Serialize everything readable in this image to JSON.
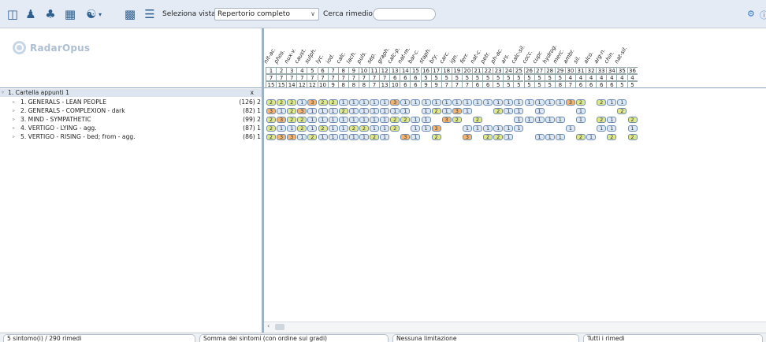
{
  "toolbar": {
    "view_label": "Seleziona vista",
    "view_value": "Repertorio completo",
    "search_label": "Cerca rimedio:",
    "search_value": "",
    "icons": [
      "window-icon",
      "person-icon",
      "tree-icon",
      "book-icon",
      "yin-yang-icon",
      "compare-icon",
      "list-icon"
    ]
  },
  "logo_text": "RadarOpus",
  "clipboard": {
    "title": "1. Cartella appunti 1",
    "close": "x",
    "rubrics": [
      {
        "label": "1. GENERALS - LEAN PEOPLE",
        "count": "(126) 2"
      },
      {
        "label": "2. GENERALS - COMPLEXION - dark",
        "count": "(82) 1"
      },
      {
        "label": "3. MIND - SYMPATHETIC",
        "count": "(99) 2"
      },
      {
        "label": "4. VERTIGO - LYING - agg.",
        "count": "(87) 1"
      },
      {
        "label": "5. VERTIGO - RISING - bed; from - agg.",
        "count": "(86) 1"
      }
    ]
  },
  "remedies": [
    "nit-ac.",
    "phos.",
    "nux-v.",
    "caust.",
    "sulph.",
    "lyc.",
    "iod.",
    "calc.",
    "lach.",
    "puls.",
    "sep.",
    "graph.",
    "calc-p.",
    "nat-m.",
    "bar-c.",
    "staph.",
    "bry.",
    "carc.",
    "ign.",
    "ferr.",
    "nat-c.",
    "petr.",
    "ph-ac.",
    "ars.",
    "calc-sil.",
    "cocc.",
    "cupr.",
    "hydrog.",
    "merc.",
    "ambr.",
    "sil.",
    "alco.",
    "arg-n.",
    "chin.",
    "nat-sil."
  ],
  "rank_row": [
    "1",
    "2",
    "3",
    "4",
    "5",
    "6",
    "7",
    "8",
    "9",
    "10",
    "11",
    "12",
    "13",
    "14",
    "15",
    "16",
    "17",
    "18",
    "19",
    "20",
    "21",
    "22",
    "23",
    "24",
    "25",
    "26",
    "27",
    "28",
    "29",
    "30",
    "31",
    "32",
    "33",
    "34",
    "35",
    "36"
  ],
  "hits_row": [
    "7",
    "7",
    "7",
    "7",
    "7",
    "7",
    "7",
    "7",
    "7",
    "7",
    "7",
    "7",
    "6",
    "6",
    "6",
    "5",
    "5",
    "5",
    "5",
    "5",
    "5",
    "5",
    "5",
    "5",
    "5",
    "5",
    "5",
    "5",
    "5",
    "4",
    "4",
    "4",
    "4",
    "4",
    "4",
    "4"
  ],
  "score_row": [
    "15",
    "15",
    "14",
    "12",
    "12",
    "10",
    "9",
    "8",
    "8",
    "8",
    "7",
    "13",
    "10",
    "6",
    "6",
    "9",
    "9",
    "7",
    "7",
    "7",
    "6",
    "6",
    "5",
    "5",
    "5",
    "5",
    "5",
    "5",
    "8",
    "7",
    "6",
    "6",
    "6",
    "6",
    "5",
    "5"
  ],
  "grid": [
    [
      2,
      2,
      2,
      1,
      3,
      2,
      2,
      1,
      1,
      1,
      1,
      1,
      3,
      1,
      1,
      1,
      1,
      1,
      1,
      1,
      1,
      1,
      1,
      1,
      1,
      1,
      1,
      1,
      1,
      3,
      2,
      0,
      2,
      1,
      1,
      0
    ],
    [
      3,
      1,
      2,
      3,
      1,
      1,
      1,
      2,
      1,
      1,
      1,
      1,
      1,
      1,
      0,
      1,
      2,
      1,
      3,
      1,
      0,
      0,
      2,
      1,
      1,
      0,
      1,
      0,
      0,
      0,
      1,
      0,
      0,
      0,
      2,
      0
    ],
    [
      2,
      3,
      2,
      2,
      1,
      1,
      1,
      1,
      1,
      1,
      1,
      1,
      2,
      2,
      1,
      1,
      0,
      3,
      2,
      0,
      2,
      0,
      0,
      0,
      1,
      1,
      1,
      1,
      1,
      0,
      1,
      0,
      2,
      1,
      0,
      2
    ],
    [
      2,
      1,
      1,
      2,
      1,
      2,
      1,
      1,
      2,
      2,
      1,
      1,
      2,
      0,
      1,
      1,
      3,
      0,
      0,
      1,
      1,
      1,
      1,
      1,
      1,
      0,
      0,
      0,
      0,
      1,
      0,
      0,
      1,
      1,
      0,
      1
    ],
    [
      2,
      3,
      3,
      1,
      2,
      1,
      1,
      1,
      1,
      1,
      2,
      1,
      0,
      3,
      1,
      0,
      2,
      0,
      0,
      3,
      0,
      2,
      2,
      1,
      0,
      0,
      1,
      1,
      1,
      0,
      2,
      1,
      0,
      2,
      0,
      2
    ]
  ],
  "status": [
    "5 sintomo(i) / 290 rimedi",
    "Somma dei sintomi (con ordine sui gradi)",
    "Nessuna limitazione",
    "Tutti i rimedi"
  ],
  "colors": {
    "grade1": "#dbe8f7",
    "grade2": "#dfe98a",
    "grade3": "#f2b571",
    "toolbar": "#e4ebf4"
  }
}
